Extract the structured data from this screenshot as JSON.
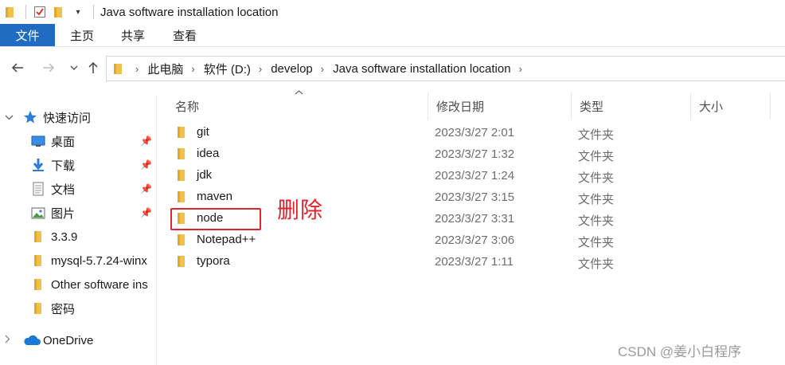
{
  "window": {
    "title": "Java software installation location"
  },
  "ribbon": {
    "tabs": [
      {
        "label": "文件"
      },
      {
        "label": "主页"
      },
      {
        "label": "共享"
      },
      {
        "label": "查看"
      }
    ]
  },
  "address": {
    "crumbs": [
      "此电脑",
      "软件 (D:)",
      "develop",
      "Java software installation location"
    ]
  },
  "sidebar": {
    "quick_access": "快速访问",
    "items": [
      {
        "label": "桌面",
        "pinned": true
      },
      {
        "label": "下载",
        "pinned": true
      },
      {
        "label": "文档",
        "pinned": true
      },
      {
        "label": "图片",
        "pinned": true
      },
      {
        "label": "3.3.9",
        "pinned": false
      },
      {
        "label": "mysql-5.7.24-winx",
        "pinned": false
      },
      {
        "label": "Other software ins",
        "pinned": false
      },
      {
        "label": "密码",
        "pinned": false
      }
    ],
    "onedrive": "OneDrive"
  },
  "columns": {
    "name": "名称",
    "date": "修改日期",
    "type": "类型",
    "size": "大小"
  },
  "files": [
    {
      "name": "git",
      "date": "2023/3/27 2:01",
      "type": "文件夹"
    },
    {
      "name": "idea",
      "date": "2023/3/27 1:32",
      "type": "文件夹"
    },
    {
      "name": "jdk",
      "date": "2023/3/27 1:24",
      "type": "文件夹"
    },
    {
      "name": "maven",
      "date": "2023/3/27 3:15",
      "type": "文件夹"
    },
    {
      "name": "node",
      "date": "2023/3/27 3:31",
      "type": "文件夹"
    },
    {
      "name": "Notepad++",
      "date": "2023/3/27 3:06",
      "type": "文件夹"
    },
    {
      "name": "typora",
      "date": "2023/3/27 1:11",
      "type": "文件夹"
    }
  ],
  "annotation": {
    "text": "删除"
  },
  "watermark": {
    "text": "CSDN @姜小白程序"
  },
  "colors": {
    "accent": "#1f6cc2",
    "folder": "#f2c14b",
    "annotation": "#e0242d"
  }
}
